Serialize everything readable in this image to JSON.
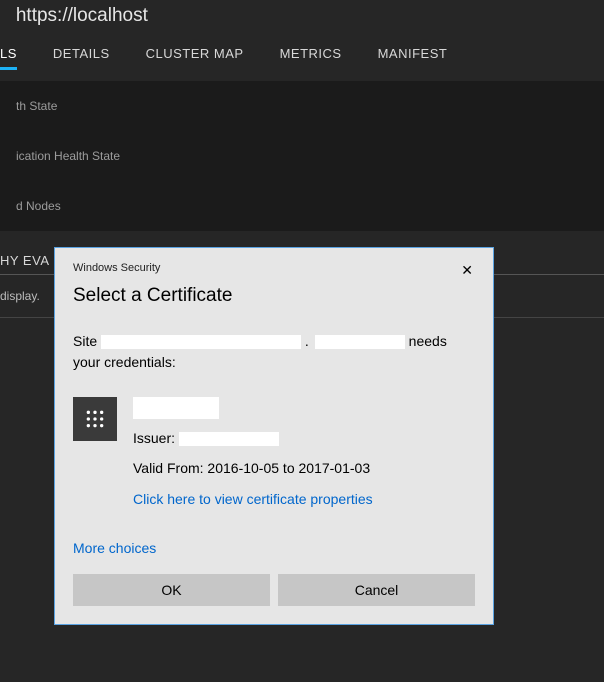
{
  "url": "https://localhost",
  "tabs": [
    {
      "label": "LS",
      "active": true
    },
    {
      "label": "DETAILS",
      "active": false
    },
    {
      "label": "CLUSTER MAP",
      "active": false
    },
    {
      "label": "METRICS",
      "active": false
    },
    {
      "label": "MANIFEST",
      "active": false
    }
  ],
  "panel_rows": [
    "th State",
    "ication Health State",
    "d Nodes"
  ],
  "section_label": "HY EVA",
  "display_row": "display.",
  "dialog": {
    "window_title": "Windows Security",
    "title": "Select a Certificate",
    "msg_prefix": "Site ",
    "msg_suffix": " needs your credentials:",
    "issuer_prefix": "Issuer: ",
    "valid_text": "Valid From: 2016-10-05 to 2017-01-03",
    "view_props": "Click here to view certificate properties",
    "more_choices": "More choices",
    "ok": "OK",
    "cancel": "Cancel"
  }
}
